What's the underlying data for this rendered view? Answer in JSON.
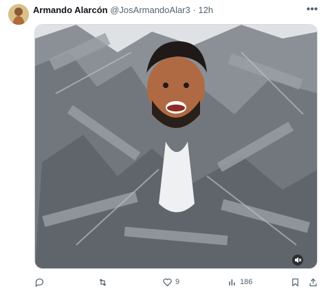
{
  "post": {
    "author_name": "Armando Alarcón",
    "author_handle": "@JosArmandoAlar3",
    "separator": "·",
    "timestamp": "12h",
    "more_icon": "more-horizontal-icon"
  },
  "media": {
    "description_icon": "sound-muted-icon"
  },
  "actions": {
    "reply_icon": "reply-icon",
    "repost_icon": "repost-icon",
    "like_icon": "heart-icon",
    "like_count": "9",
    "views_icon": "views-icon",
    "views_count": "186",
    "bookmark_icon": "bookmark-icon",
    "share_icon": "share-icon"
  },
  "colors": {
    "text_primary": "#0f1419",
    "text_secondary": "#536471",
    "border": "#cfd9de",
    "tape": "#7d8288"
  }
}
